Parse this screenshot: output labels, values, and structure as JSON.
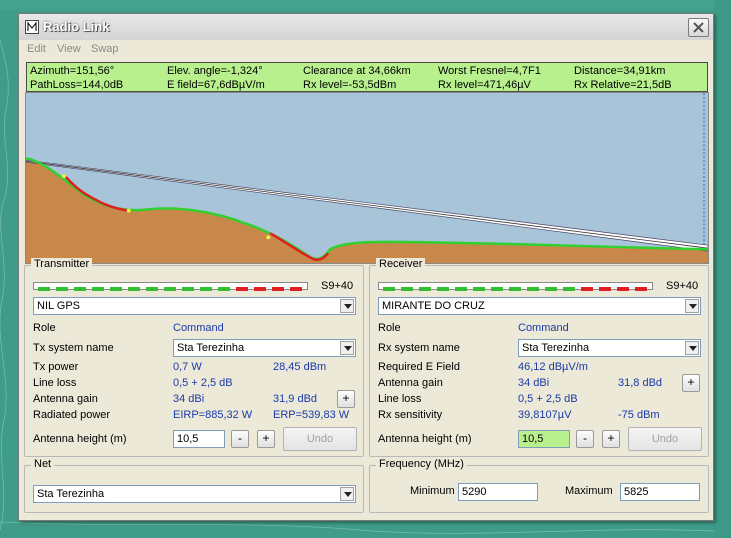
{
  "window": {
    "title": "Radio Link"
  },
  "menu": [
    "Edit",
    "View",
    "Swap"
  ],
  "info": {
    "row1": [
      "Azimuth=151,56°",
      "Elev. angle=-1,324°",
      "Clearance at 34,66km",
      "Worst Fresnel=4,7F1",
      "Distance=34,91km"
    ],
    "row2": [
      "PathLoss=144,0dB",
      "E field=67,6dBµV/m",
      "Rx level=-53,5dBm",
      "Rx level=471,46µV",
      "Rx Relative=21,5dB"
    ]
  },
  "profile": {
    "colors": {
      "sky": "#a8c4d8",
      "terrain": "#c8884a",
      "clear": "#30d030",
      "obstructed": "#e02020"
    }
  },
  "transmitter": {
    "title": "Transmitter",
    "meter_label": "S9+40",
    "station": "NIL GPS",
    "role_label": "Role",
    "role": "Command",
    "system_label": "Tx system name",
    "system": "Sta Terezinha",
    "power_label": "Tx power",
    "power_w": "0,7 W",
    "power_dbm": "28,45 dBm",
    "loss_label": "Line loss",
    "loss": "0,5 + 2,5 dB",
    "gain_label": "Antenna gain",
    "gain_dbi": "34 dBi",
    "gain_dbd": "31,9 dBd",
    "radiated_label": "Radiated power",
    "eirp": "EIRP=885,32 W",
    "erp": "ERP=539,83 W",
    "height_label": "Antenna height (m)",
    "height": "10,5",
    "undo": "Undo"
  },
  "receiver": {
    "title": "Receiver",
    "meter_label": "S9+40",
    "station": "MIRANTE DO CRUZ",
    "role_label": "Role",
    "role": "Command",
    "system_label": "Rx system name",
    "system": "Sta Terezinha",
    "field_label": "Required E Field",
    "field": "46,12 dBµV/m",
    "gain_label": "Antenna gain",
    "gain_dbi": "34 dBi",
    "gain_dbd": "31,8 dBd",
    "loss_label": "Line loss",
    "loss": "0,5 + 2,5 dB",
    "sens_label": "Rx sensitivity",
    "sens_uv": "39,8107µV",
    "sens_dbm": "-75 dBm",
    "height_label": "Antenna height (m)",
    "height": "10,5",
    "undo": "Undo"
  },
  "net": {
    "title": "Net",
    "value": "Sta Terezinha"
  },
  "frequency": {
    "title": "Frequency (MHz)",
    "min_label": "Minimum",
    "min": "5290",
    "max_label": "Maximum",
    "max": "5825"
  },
  "buttons": {
    "minus": "-",
    "plus": "+"
  }
}
